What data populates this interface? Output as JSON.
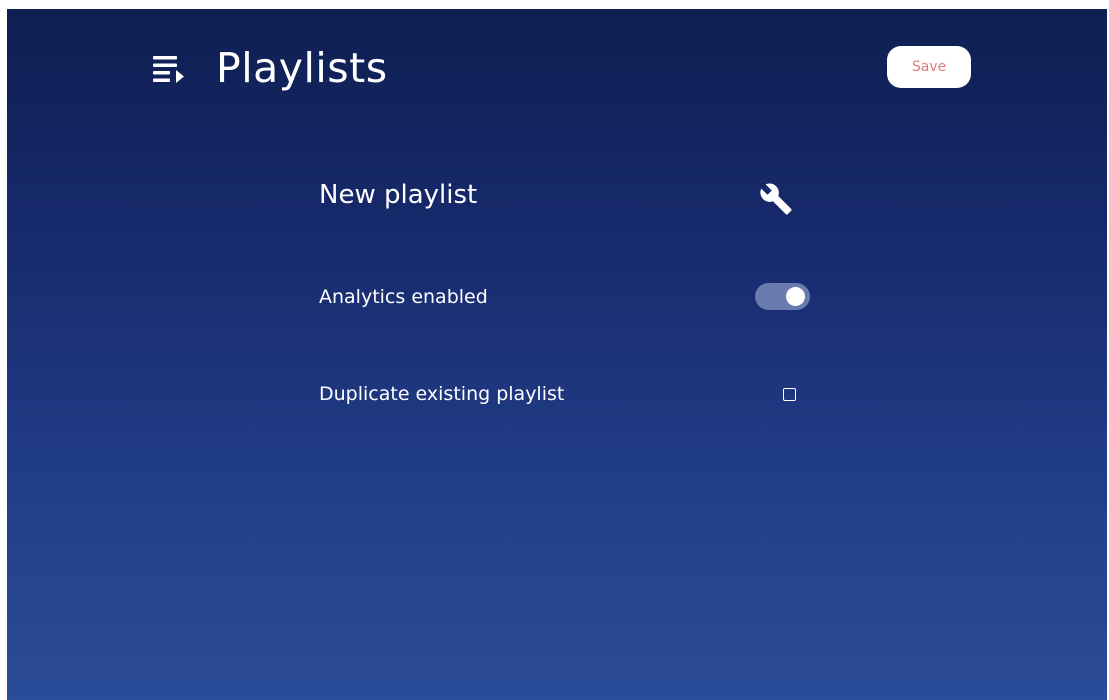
{
  "header": {
    "title": "Playlists",
    "icon": "playlist-icon",
    "save_label": "Save"
  },
  "settings": {
    "new_playlist_label": "New playlist",
    "new_playlist_icon": "wrench-icon",
    "analytics_label": "Analytics enabled",
    "analytics_enabled": true,
    "duplicate_label": "Duplicate existing playlist",
    "duplicate_checked": false
  },
  "colors": {
    "background_top": "#0f1f52",
    "background_bottom": "#2b4c98",
    "save_text": "#e07a7a",
    "toggle_track": "#6a7bb0"
  }
}
